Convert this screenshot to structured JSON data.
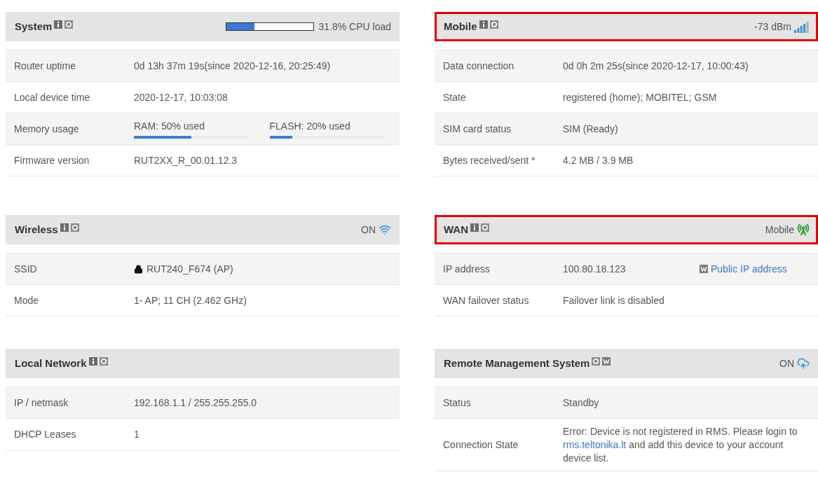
{
  "columns": [
    {
      "panels": [
        {
          "title": "System",
          "icons": [
            {
              "kind": "info"
            },
            {
              "kind": "settings"
            }
          ],
          "highlighted": false,
          "indicator": {
            "kind": "cpu",
            "level": 0.318,
            "text": "31.8% CPU load"
          },
          "rows": [
            {
              "label": "Router uptime",
              "kind": "text",
              "value": "0d 13h 37m 19s(since 2020-12-16, 20:25:49)"
            },
            {
              "label": "Local device time",
              "kind": "text",
              "value": "2020-12-17, 10:03:08"
            },
            {
              "label": "Memory usage",
              "kind": "meters",
              "meters": [
                {
                  "text": "RAM: 50% used",
                  "level": 0.5
                },
                {
                  "text": "FLASH: 20% used",
                  "level": 0.2
                }
              ]
            },
            {
              "label": "Firmware version",
              "kind": "text",
              "value": "RUT2XX_R_00.01.12.3"
            }
          ]
        },
        {
          "title": "Wireless",
          "icons": [
            {
              "kind": "info"
            },
            {
              "kind": "settings"
            }
          ],
          "highlighted": false,
          "indicator": {
            "kind": "wifi",
            "text": "ON"
          },
          "rows": [
            {
              "label": "SSID",
              "kind": "locked",
              "value": "RUT240_F674 (AP)"
            },
            {
              "label": "Mode",
              "kind": "text",
              "value": "1- AP; 11 CH (2.462 GHz)"
            }
          ]
        },
        {
          "title": "Local Network",
          "icons": [
            {
              "kind": "info"
            },
            {
              "kind": "settings"
            }
          ],
          "highlighted": false,
          "rows": [
            {
              "label": "IP / netmask",
              "kind": "text",
              "value": "192.168.1.1 / 255.255.255.0"
            },
            {
              "label": "DHCP Leases",
              "kind": "text",
              "value": "1"
            }
          ]
        }
      ]
    },
    {
      "panels": [
        {
          "title": "Mobile",
          "icons": [
            {
              "kind": "info"
            },
            {
              "kind": "settings"
            }
          ],
          "highlighted": true,
          "indicator": {
            "kind": "signal",
            "text": "-73 dBm"
          },
          "rows": [
            {
              "label": "Data connection",
              "kind": "text",
              "value": "0d 0h 2m 25s(since 2020-12-17, 10:00:43)"
            },
            {
              "label": "State",
              "kind": "text",
              "value": "registered (home); MOBITEL; GSM"
            },
            {
              "label": "SIM card status",
              "kind": "text",
              "value": "SIM (Ready)"
            },
            {
              "label": "Bytes received/sent *",
              "kind": "text",
              "value": "4.2 MB / 3.9 MB"
            }
          ]
        },
        {
          "title": "WAN",
          "icons": [
            {
              "kind": "info"
            },
            {
              "kind": "settings"
            }
          ],
          "highlighted": true,
          "indicator": {
            "kind": "antenna",
            "text": "Mobile"
          },
          "rows": [
            {
              "label": "IP address",
              "kind": "link",
              "value": "100.80.18.123",
              "link": "Public IP address"
            },
            {
              "label": "WAN failover status",
              "kind": "text",
              "value": "Failover link is disabled"
            }
          ]
        },
        {
          "title": "Remote Management System",
          "icons": [
            {
              "kind": "settings"
            },
            {
              "kind": "web"
            }
          ],
          "highlighted": false,
          "indicator": {
            "kind": "cloud",
            "text": "ON"
          },
          "rows": [
            {
              "label": "Status",
              "kind": "text",
              "value": "Standby"
            },
            {
              "label": "Connection State",
              "kind": "message",
              "before": "Error: Device is not registered in RMS. Please login to ",
              "link": "rms.teltonika.lt",
              "after": " and add this device to your account device list."
            }
          ]
        }
      ]
    }
  ]
}
